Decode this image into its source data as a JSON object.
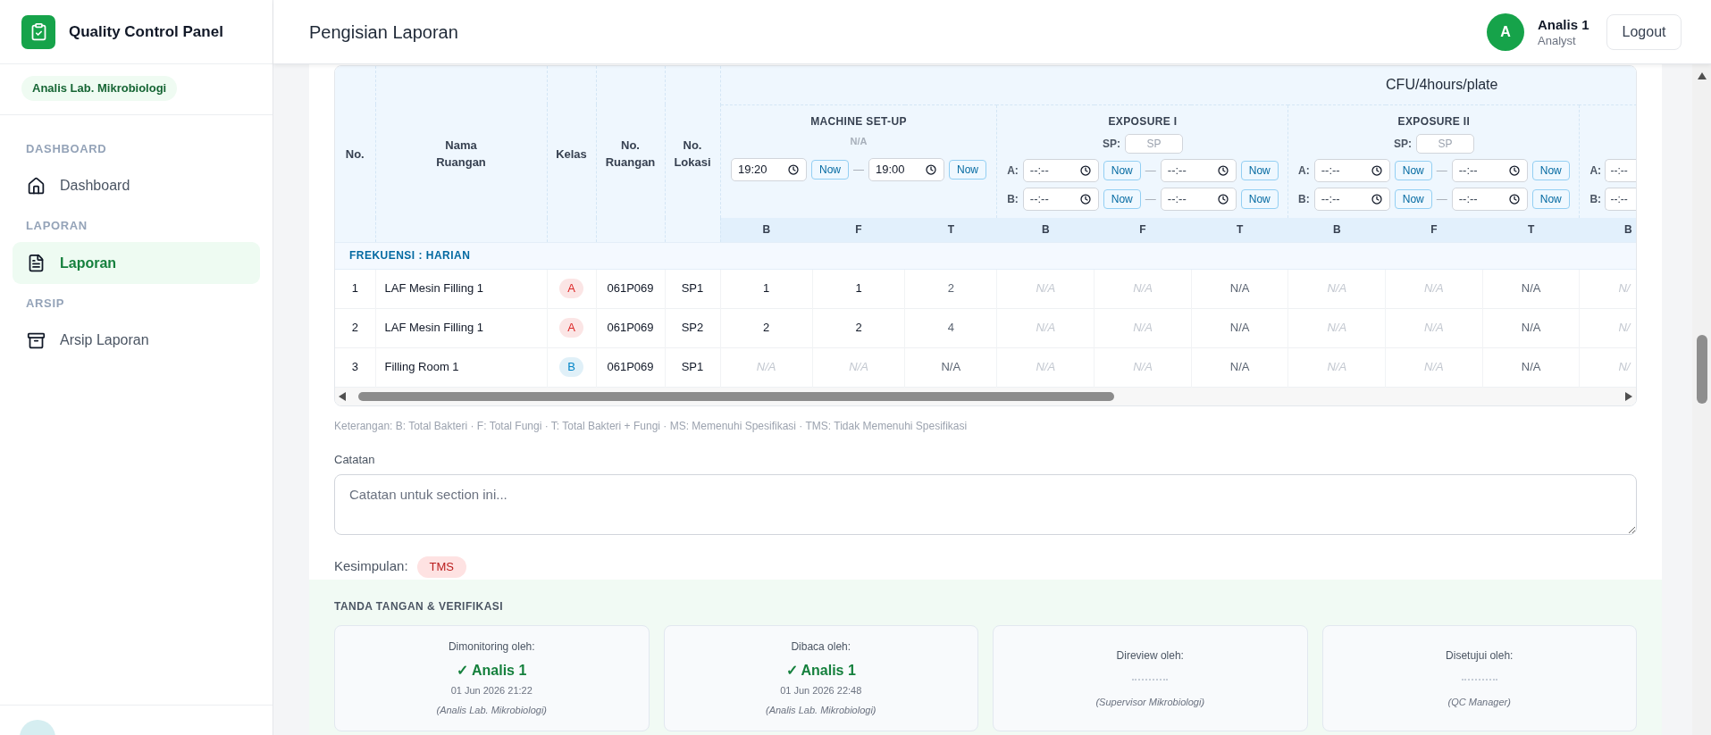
{
  "sidebar": {
    "app_title": "Quality Control Panel",
    "role_badge": "Analis Lab. Mikrobiologi",
    "sections": [
      {
        "heading": "DASHBOARD",
        "items": [
          {
            "label": "Dashboard",
            "kind": "home",
            "selected": false
          }
        ]
      },
      {
        "heading": "LAPORAN",
        "items": [
          {
            "label": "Laporan",
            "kind": "document",
            "selected": true
          }
        ]
      },
      {
        "heading": "ARSIP",
        "items": [
          {
            "label": "Arsip Laporan",
            "kind": "archive",
            "selected": false
          }
        ]
      }
    ]
  },
  "header": {
    "title": "Pengisian Laporan",
    "user": {
      "initial": "A",
      "name": "Analis 1",
      "role": "Analyst"
    },
    "logout": "Logout"
  },
  "table": {
    "columns": [
      "No.",
      "Nama Ruangan",
      "Kelas",
      "No. Ruangan",
      "No. Lokasi"
    ],
    "group_heading": "CFU/4hours/plate",
    "groups": [
      {
        "kind": "setup",
        "title": "MACHINE SET-UP",
        "status": "N/A",
        "times": [
          {
            "start": {
              "value": "19:20"
            },
            "start_button": "Now",
            "separator": "—",
            "end": {
              "value": "19:00"
            },
            "end_button": "Now"
          }
        ],
        "subcolumns": [
          "B",
          "F",
          "T"
        ]
      },
      {
        "kind": "exposure",
        "title": "EXPOSURE I",
        "sp": {
          "label": "SP:",
          "placeholder": "SP"
        },
        "times": [
          {
            "label": "A:",
            "start": {
              "placeholder": "--:--"
            },
            "start_button": "Now",
            "separator": "—",
            "end": {
              "placeholder": "--:--"
            },
            "end_button": "Now"
          },
          {
            "label": "B:",
            "start": {
              "placeholder": "--:--"
            },
            "start_button": "Now",
            "separator": "—",
            "end": {
              "placeholder": "--:--"
            },
            "end_button": "Now"
          }
        ],
        "subcolumns": [
          "B",
          "F",
          "T"
        ]
      },
      {
        "kind": "exposure",
        "title": "EXPOSURE II",
        "sp": {
          "label": "SP:",
          "placeholder": "SP"
        },
        "times": [
          {
            "label": "A:",
            "start": {
              "placeholder": "--:--"
            },
            "start_button": "Now",
            "separator": "—",
            "end": {
              "placeholder": "--:--"
            },
            "end_button": "Now"
          },
          {
            "label": "B:",
            "start": {
              "placeholder": "--:--"
            },
            "start_button": "Now",
            "separator": "—",
            "end": {
              "placeholder": "--:--"
            },
            "end_button": "Now"
          }
        ],
        "subcolumns": [
          "B",
          "F",
          "T"
        ]
      },
      {
        "kind": "cut",
        "times": [
          {
            "label": "A:",
            "start": {
              "placeholder": "--:--"
            }
          },
          {
            "label": "B:",
            "start": {
              "placeholder": "--:--"
            }
          }
        ],
        "subcolumns": [
          "B"
        ]
      }
    ],
    "frequency": "FREKUENSI : HARIAN",
    "rows": [
      {
        "no": "1",
        "name": "LAF Mesin Filling 1",
        "class": {
          "text": "A",
          "color": "#dc2626"
        },
        "room": "061P069",
        "location": "SP1",
        "cells": [
          {
            "text": "1",
            "kind": "value"
          },
          {
            "text": "1",
            "kind": "value"
          },
          {
            "text": "2",
            "kind": "total"
          },
          {
            "text": "N/A",
            "kind": "blank"
          },
          {
            "text": "N/A",
            "kind": "blank"
          },
          {
            "text": "N/A",
            "kind": "total"
          },
          {
            "text": "N/A",
            "kind": "blank"
          },
          {
            "text": "N/A",
            "kind": "blank"
          },
          {
            "text": "N/A",
            "kind": "total"
          },
          {
            "text": "N/",
            "kind": "blank"
          }
        ]
      },
      {
        "no": "2",
        "name": "LAF Mesin Filling 1",
        "class": {
          "text": "A",
          "color": "#dc2626"
        },
        "room": "061P069",
        "location": "SP2",
        "cells": [
          {
            "text": "2",
            "kind": "value"
          },
          {
            "text": "2",
            "kind": "value"
          },
          {
            "text": "4",
            "kind": "total"
          },
          {
            "text": "N/A",
            "kind": "blank"
          },
          {
            "text": "N/A",
            "kind": "blank"
          },
          {
            "text": "N/A",
            "kind": "total"
          },
          {
            "text": "N/A",
            "kind": "blank"
          },
          {
            "text": "N/A",
            "kind": "blank"
          },
          {
            "text": "N/A",
            "kind": "total"
          },
          {
            "text": "N/",
            "kind": "blank"
          }
        ]
      },
      {
        "no": "3",
        "name": "Filling Room 1",
        "class": {
          "text": "B",
          "color": "#0284c7"
        },
        "room": "061P069",
        "location": "SP1",
        "cells": [
          {
            "text": "N/A",
            "kind": "blank"
          },
          {
            "text": "N/A",
            "kind": "blank"
          },
          {
            "text": "N/A",
            "kind": "total"
          },
          {
            "text": "N/A",
            "kind": "blank"
          },
          {
            "text": "N/A",
            "kind": "blank"
          },
          {
            "text": "N/A",
            "kind": "total"
          },
          {
            "text": "N/A",
            "kind": "blank"
          },
          {
            "text": "N/A",
            "kind": "blank"
          },
          {
            "text": "N/A",
            "kind": "total"
          },
          {
            "text": "N/",
            "kind": "blank"
          }
        ]
      }
    ]
  },
  "legend": "Keterangan: B: Total Bakteri · F: Total Fungi · T: Total Bakteri + Fungi · MS: Memenuhi Spesifikasi · TMS: Tidak Memenuhi Spesifikasi",
  "notes": {
    "label": "Catatan",
    "placeholder": "Catatan untuk section ini..."
  },
  "conclusion": {
    "label": "Kesimpulan:",
    "value": "TMS",
    "kind": "fail"
  },
  "signatures": {
    "heading": "TANDA TANGAN & VERIFIKASI",
    "cards": [
      {
        "role_label": "Dimonitoring oleh:",
        "signed": true,
        "signer": "✓ Analis 1",
        "timestamp": "01 Jun 2026 21:22",
        "position": "(Analis Lab. Mikrobiologi)"
      },
      {
        "role_label": "Dibaca oleh:",
        "signed": true,
        "signer": "✓ Analis 1",
        "timestamp": "01 Jun 2026 22:48",
        "position": "(Analis Lab. Mikrobiologi)"
      },
      {
        "role_label": "Direview oleh:",
        "signed": false,
        "position": "(Supervisor Mikrobiologi)"
      },
      {
        "role_label": "Disetujui oleh:",
        "signed": false,
        "position": "(QC Manager)"
      }
    ]
  }
}
